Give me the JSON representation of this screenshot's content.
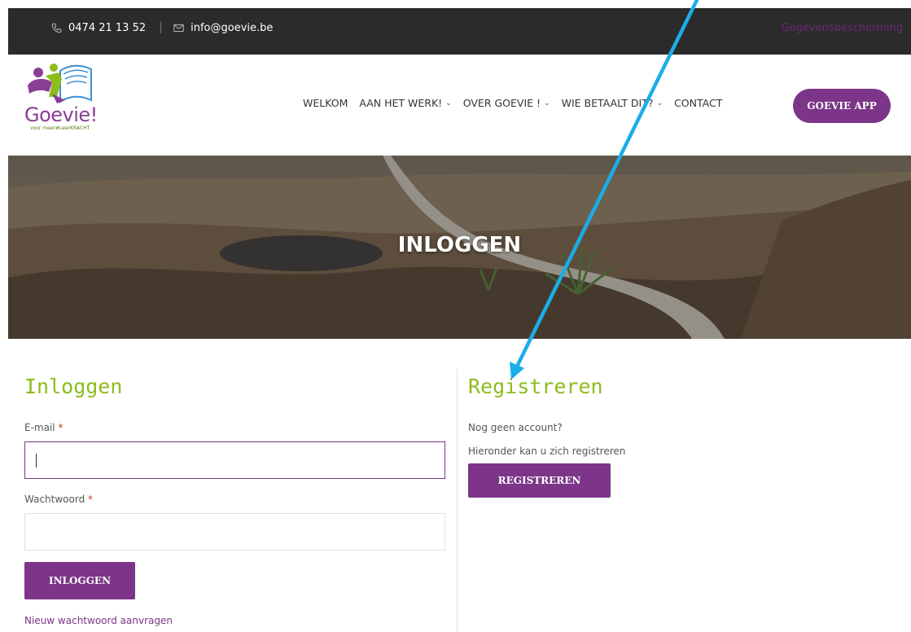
{
  "topbar": {
    "phone": "0474 21 13 52",
    "email": "info@goevie.be",
    "privacy_link": "Gegevensbescherming",
    "phone_icon": "phone-icon",
    "email_icon": "envelope-icon"
  },
  "logo": {
    "wordmark": "Goevie!",
    "tagline": "voor meer#LeerKRACHT"
  },
  "nav": {
    "items": [
      {
        "label": "WELKOM",
        "has_dropdown": false
      },
      {
        "label": "AAN HET WERK!",
        "has_dropdown": true
      },
      {
        "label": "OVER GOEVIE !",
        "has_dropdown": true
      },
      {
        "label": "WIE BETAALT DIT?",
        "has_dropdown": true
      },
      {
        "label": "CONTACT",
        "has_dropdown": false
      }
    ],
    "app_button": "GOEVIE APP"
  },
  "hero": {
    "title": "INLOGGEN"
  },
  "login": {
    "heading": "Inloggen",
    "email_label": "E-mail",
    "email_value": "",
    "password_label": "Wachtwoord",
    "password_value": "",
    "required_marker": "*",
    "submit": "INLOGGEN",
    "forgot_link": "Nieuw wachtwoord aanvragen"
  },
  "register": {
    "heading": "Registreren",
    "line1": "Nog geen account?",
    "line2": "Hieronder kan u zich registreren",
    "button": "REGISTREREN"
  },
  "colors": {
    "topbar_bg": "#2b2b2b",
    "accent_purple": "#7c3588",
    "heading_green": "#8cbd1c",
    "annotation_arrow": "#1aaee8"
  }
}
